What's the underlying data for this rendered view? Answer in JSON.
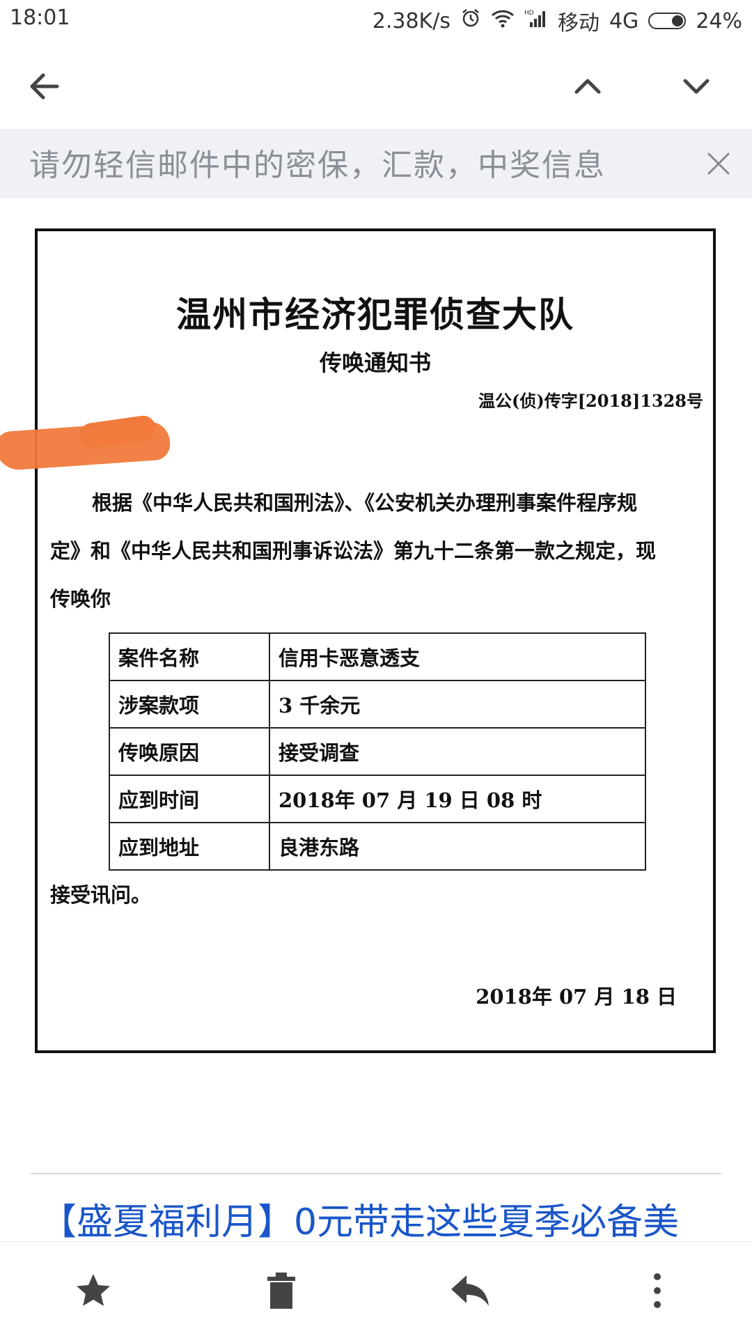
{
  "status_bar": {
    "time": "18:01",
    "net_speed": "2.38K/s",
    "carrier": "移动",
    "network": "4G",
    "battery": "24%"
  },
  "toolbar": {
    "back_icon": "arrow-left-icon",
    "prev_icon": "chevron-up-icon",
    "next_icon": "chevron-down-icon"
  },
  "banner": {
    "text": "请勿轻信邮件中的密保，汇款，中奖信息",
    "close_icon": "close-icon"
  },
  "document": {
    "title": "温州市经济犯罪侦查大队",
    "subtitle": "传唤通知书",
    "doc_number": "温公(侦)传字[2018]1328号",
    "para_line1": "根据《中华人民共和国刑法》、《公安机关办理刑事案件程序规",
    "para_line2": "定》和《中华人民共和国刑事诉讼法》第九十二条第一款之规定，现",
    "para_line3": "传唤你",
    "table": [
      {
        "key": "案件名称",
        "value": "信用卡恶意透支"
      },
      {
        "key": "涉案款项",
        "value": "3 千余元"
      },
      {
        "key": "传唤原因",
        "value": "接受调查"
      },
      {
        "key": "应到时间",
        "value": "2018年 07 月 19 日 08 时"
      },
      {
        "key": "应到地址",
        "value": "良港东路"
      }
    ],
    "tail": "接受讯问。",
    "date": "2018年 07 月 18 日"
  },
  "promo": {
    "text": "【盛夏福利月】0元带走这些夏季必备美"
  },
  "bottom_bar": {
    "star_icon": "star-icon",
    "delete_icon": "trash-icon",
    "reply_icon": "reply-icon",
    "more_icon": "more-vertical-icon"
  },
  "colors": {
    "promo_link": "#1a56c9",
    "banner_bg": "#eff1f4",
    "redaction": "#f07a3c"
  }
}
